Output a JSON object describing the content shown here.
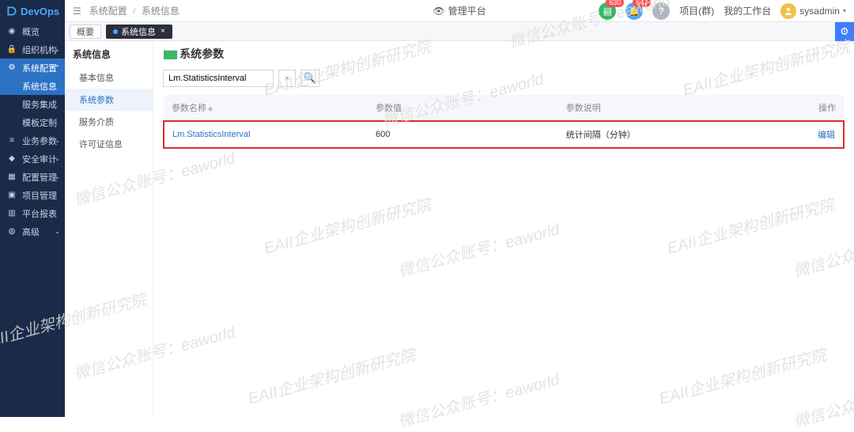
{
  "brand": "DevOps",
  "breadcrumb": {
    "a": "系统配置",
    "b": "系统信息"
  },
  "top_center": "管理平台",
  "badges": {
    "green": "630",
    "blue": "647"
  },
  "top_links": {
    "projects": "项目(群)",
    "workbench": "我的工作台"
  },
  "user": {
    "name": "sysadmin"
  },
  "sidebar": {
    "overview": "概览",
    "org": "组织机构",
    "sysconf": "系统配置",
    "sysinfo": "系统信息",
    "svcint": "服务集成",
    "tplcust": "模板定制",
    "bizparam": "业务参数",
    "secaudit": "安全审计",
    "confmgmt": "配置管理",
    "projmgmt": "项目管理",
    "report": "平台报表",
    "advanced": "高级"
  },
  "tabs": {
    "t1": "概要",
    "t2": "系统信息"
  },
  "innernav": {
    "title": "系统信息",
    "basic": "基本信息",
    "params": "系统参数",
    "svc": "服务介质",
    "lic": "许可证信息"
  },
  "main": {
    "title": "系统参数",
    "search_value": "Lm.StatisticsInterval",
    "columns": {
      "name": "参数名称",
      "value": "参数值",
      "desc": "参数说明",
      "action": "操作"
    },
    "row": {
      "name": "Lm.StatisticsInterval",
      "value": "600",
      "desc": "统计间隔（分钟）",
      "action": "编辑"
    }
  },
  "watermarks": {
    "a": "EAII企业架构创新研究院",
    "b": "微信公众账号：eaworld"
  }
}
